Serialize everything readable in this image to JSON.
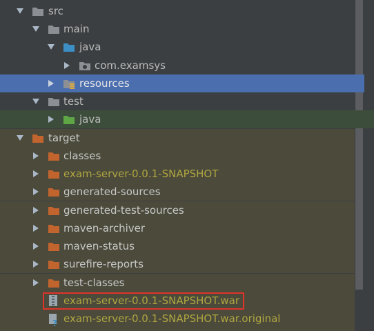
{
  "tree": {
    "src": "src",
    "main": "main",
    "main_java": "java",
    "com_examsys": "com.examsys",
    "resources": "resources",
    "test": "test",
    "test_java": "java",
    "target": "target",
    "classes": "classes",
    "exam_server_snapshot": "exam-server-0.0.1-SNAPSHOT",
    "generated_sources": "generated-sources",
    "generated_test_sources": "generated-test-sources",
    "maven_archiver": "maven-archiver",
    "maven_status": "maven-status",
    "surefire_reports": "surefire-reports",
    "test_classes": "test-classes",
    "war_file": "exam-server-0.0.1-SNAPSHOT.war",
    "war_original_file": "exam-server-0.0.1-SNAPSHOT.war.original"
  },
  "colors": {
    "background": "#3c3f41",
    "selection_blue": "#4b6eaf",
    "selection_green": "#3d4d3b",
    "excluded_bg": "#4b4a3b",
    "excluded_text": "#b0a640",
    "folder_grey": "#8c9094",
    "folder_blue": "#3b8fc4",
    "folder_green": "#5ea646",
    "folder_orange": "#c1642e",
    "highlight_border": "#e0342a"
  }
}
